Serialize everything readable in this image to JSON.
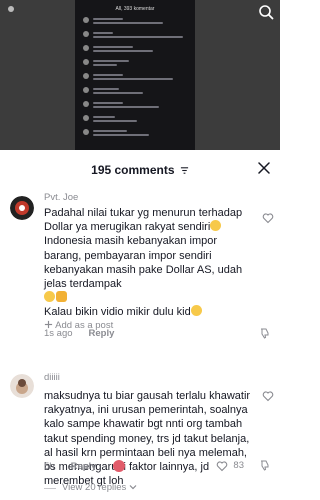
{
  "video": {
    "inner_title": "All, 393 komentar"
  },
  "sheet": {
    "title": "195 comments"
  },
  "comments": [
    {
      "username": "Pvt. Joe",
      "text_1": "Padahal nilai tukar yg menurun terhadap Dollar ya merugikan rakyat sendiri",
      "text_2": "Indonesia masih kebanyakan impor barang, pembayaran impor sendiri kebanyakan masih pake Dollar AS, udah jelas terdampak",
      "text_3": "Kalau bikin vidio mikir dulu kid",
      "time": "1s ago",
      "reply": "Reply",
      "add_post": "Add as a post"
    },
    {
      "username": "diiiii",
      "text": "maksudnya tu biar gausah terlalu khawatir rakyatnya, ini urusan pemerintah, soalnya kalo sampe khawatir bgt nnti org tambah takut spending money, trs jd takut belanja, al hasil krn permintaan beli nya melemah, bs memengaruhi faktor lainnya, jd merembet gt loh",
      "time": "5h",
      "reply": "Reply",
      "likes": "83",
      "view_replies": "View 20 replies"
    }
  ],
  "colors": {
    "text": "#161823",
    "muted": "#8a8b91",
    "emoji": "#f7c94a"
  }
}
